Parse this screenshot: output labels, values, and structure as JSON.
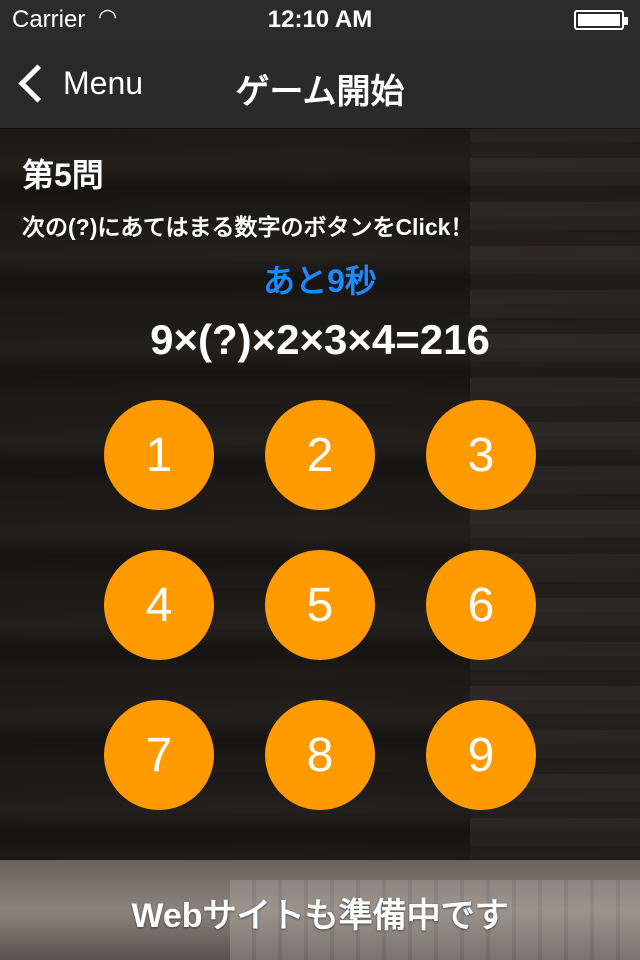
{
  "status_bar": {
    "carrier": "Carrier",
    "time": "12:10 AM"
  },
  "nav": {
    "back_label": "Menu",
    "title": "ゲーム開始"
  },
  "quiz": {
    "question_number": "第5問",
    "instruction": "次の(?)にあてはまる数字のボタンをClick！",
    "timer": "あと9秒",
    "equation": "9×(?)×2×3×4=216"
  },
  "keypad": {
    "keys": [
      "1",
      "2",
      "3",
      "4",
      "5",
      "6",
      "7",
      "8",
      "9"
    ]
  },
  "banner": {
    "text": "Webサイトも準備中です"
  },
  "colors": {
    "accent_orange": "#ff9a00",
    "timer_blue": "#1e88ff",
    "nav_background": "#2a2a2a"
  },
  "icons": {
    "back": "chevron-left-icon",
    "wifi": "wifi-icon",
    "battery": "battery-icon"
  }
}
